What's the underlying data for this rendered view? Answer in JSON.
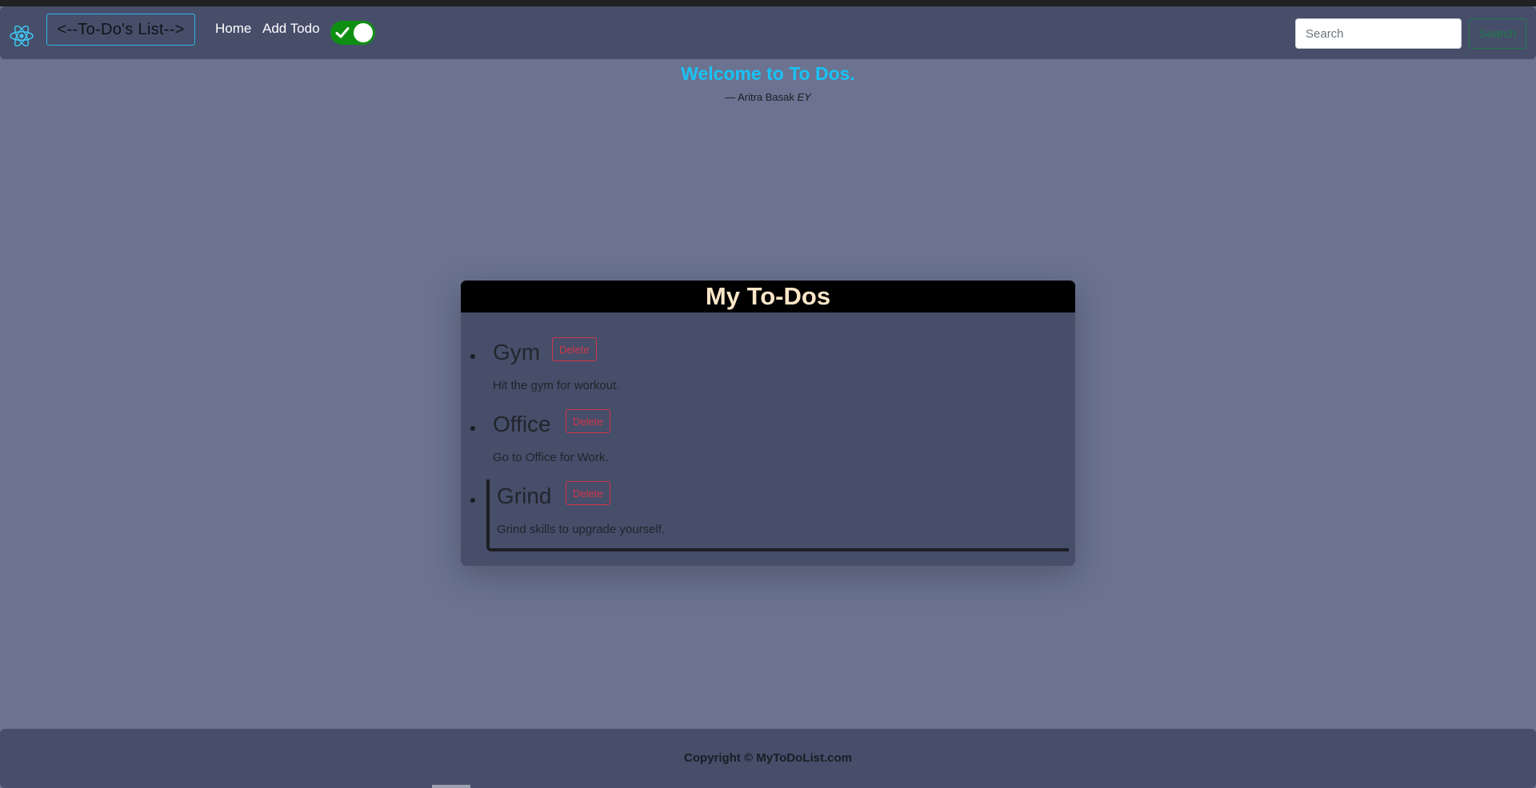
{
  "navbar": {
    "brand": "<--To-Do's List-->",
    "links": [
      {
        "label": "Home"
      },
      {
        "label": "Add Todo"
      }
    ],
    "theme_toggle_on": true,
    "search": {
      "placeholder": "Search",
      "button_label": "Search"
    }
  },
  "hero": {
    "welcome": "Welcome to To Dos.",
    "author_prefix": "— Aritra Basak ",
    "author_suffix": "EY"
  },
  "todos": {
    "heading": "My To-Dos",
    "delete_label": "Delete",
    "items": [
      {
        "title": "Gym",
        "desc": "Hit the gym for workout."
      },
      {
        "title": "Office",
        "desc": "Go to Office for Work."
      },
      {
        "title": "Grind",
        "desc": "Grind skills to upgrade yourself."
      }
    ]
  },
  "footer": {
    "copyright": "Copyright © MyToDoList.com"
  },
  "colors": {
    "page_bg": "#6b7390",
    "panel_bg": "#464e6a",
    "accent_cyan": "#19c3f5",
    "danger": "#d1364a",
    "success": "#1f7a4d",
    "toggle_on": "#0f8f12"
  }
}
